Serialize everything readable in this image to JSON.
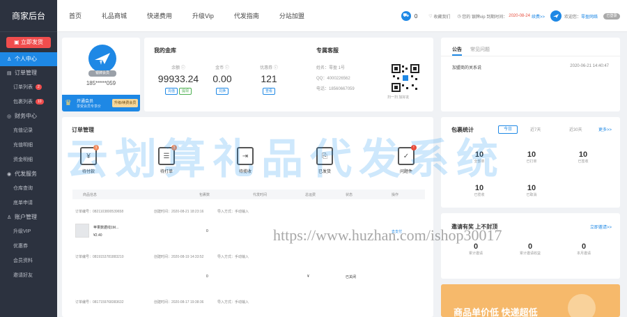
{
  "sidebar": {
    "brand": "商家后台",
    "ship_button": "立即发货",
    "groups": [
      {
        "label": "个人中心",
        "icon": "user-icon",
        "active": true
      },
      {
        "label": "订单管理",
        "icon": "list-icon",
        "items": [
          {
            "label": "订单列表",
            "badge": "2"
          },
          {
            "label": "包裹列表",
            "badge": "10"
          }
        ]
      },
      {
        "label": "财务中心",
        "icon": "finance-icon",
        "items": [
          {
            "label": "充值记录"
          },
          {
            "label": "充值明细"
          },
          {
            "label": "资金明细"
          }
        ]
      },
      {
        "label": "代发服务",
        "icon": "service-icon",
        "items": [
          {
            "label": "仓库查询"
          },
          {
            "label": "底单申请"
          }
        ]
      },
      {
        "label": "账户管理",
        "icon": "account-icon",
        "items": [
          {
            "label": "升级VIP"
          },
          {
            "label": "优惠券"
          },
          {
            "label": "会员资料"
          },
          {
            "label": "邀请好友"
          }
        ]
      }
    ]
  },
  "nav": [
    "首页",
    "礼品商城",
    "快递费用",
    "升级Vip",
    "代发指南",
    "分站加盟"
  ],
  "top": {
    "cart_count": "0",
    "favorites": "收藏我们",
    "vip_label": "您的 银牌vip 到期时间：",
    "vip_date": "2020-08-24",
    "renew": "续费>>",
    "welcome": "欢迎您：",
    "username": "零盈网络",
    "toggle": "已登录"
  },
  "profile": {
    "avatar_badge": "银牌会员",
    "phone": "185*****059",
    "promo_title": "开通会员",
    "promo_sub": "享受会员专享价",
    "promo_button": "升级/续费会员"
  },
  "wallet": {
    "title": "我的金库",
    "stats": [
      {
        "label": "余额",
        "value": "99933.24",
        "buttons": [
          "充值",
          "提现"
        ]
      },
      {
        "label": "金币",
        "value": "0.00",
        "buttons": [
          "兑换"
        ]
      },
      {
        "label": "优惠券",
        "value": "121",
        "buttons": [
          "查看"
        ]
      }
    ]
  },
  "service": {
    "title": "专属客服",
    "name_label": "姓名：零盈 1号",
    "qq_label": "QQ：4000226562",
    "phone_label": "电话：18560667059",
    "qr_caption": "扫一扫 加好友"
  },
  "notice": {
    "tabs": [
      "公告",
      "常见问题"
    ],
    "item_title": "加盟商的关系说",
    "item_time": "2020-06-21 14:40:47"
  },
  "orders": {
    "title": "订单管理",
    "icons": [
      {
        "label": "待付款",
        "glyph": "¥",
        "name": "payment-icon",
        "dot": "1"
      },
      {
        "label": "待打单",
        "glyph": "☰",
        "name": "print-list-icon",
        "dot": "1"
      },
      {
        "label": "待揽收",
        "glyph": "⇥",
        "name": "truck-icon"
      },
      {
        "label": "已发货",
        "glyph": "⎘",
        "name": "shipped-icon"
      },
      {
        "label": "问题件",
        "glyph": "✓",
        "name": "problem-icon",
        "dot": "!"
      }
    ],
    "columns": [
      "商品信息",
      "包裹数",
      "代发时间",
      "总运费",
      "状态",
      "操作"
    ],
    "rows": [
      {
        "no": "订单编号：0821103800539658",
        "time": "创建时间：2020-08-21 18:23:16",
        "method": "导入方式：手动输入",
        "product": "苹果数据线1M...",
        "price": "¥2.40",
        "count": "0",
        "op": "去支付"
      },
      {
        "no": "订单编号：0819153781883210",
        "time": "创建时间：2020-08-19 14:33:52",
        "method": "导入方式：手动输入",
        "product": "",
        "price": "",
        "count": "0",
        "fee": "¥",
        "status": "已关闭"
      },
      {
        "no": "订单编号：0817159768383632",
        "time": "创建时间：2020-08-17 19:38:36",
        "method": "导入方式：手动输入",
        "product": "",
        "price": "",
        "count": "",
        "fee": "",
        "status": ""
      }
    ]
  },
  "packages": {
    "title": "包裹统计",
    "tabs": [
      "今日",
      "近7天",
      "近30天"
    ],
    "more": "更多>>",
    "stats": [
      {
        "value": "10",
        "label": "全部单"
      },
      {
        "value": "10",
        "label": "已打单"
      },
      {
        "value": "10",
        "label": "已签收"
      },
      {
        "value": "10",
        "label": "已揽收"
      },
      {
        "value": "10",
        "label": "已取消"
      }
    ]
  },
  "invite": {
    "title": "邀请有奖 上不封顶",
    "link": "立即邀请>>",
    "stats": [
      {
        "value": "0",
        "label": "累计邀请"
      },
      {
        "value": "0",
        "label": "累计邀请收益"
      },
      {
        "value": "0",
        "label": "本月邀请"
      }
    ]
  },
  "banner": {
    "text": "商品单价低 快递超低"
  },
  "watermark": "云划算礼品代发系统",
  "watermark_url": "https://www.huzhan.com/ishop30017",
  "colors": {
    "accent": "#1e88e5",
    "sidebar": "#2c323f",
    "danger": "#f04d4d"
  }
}
